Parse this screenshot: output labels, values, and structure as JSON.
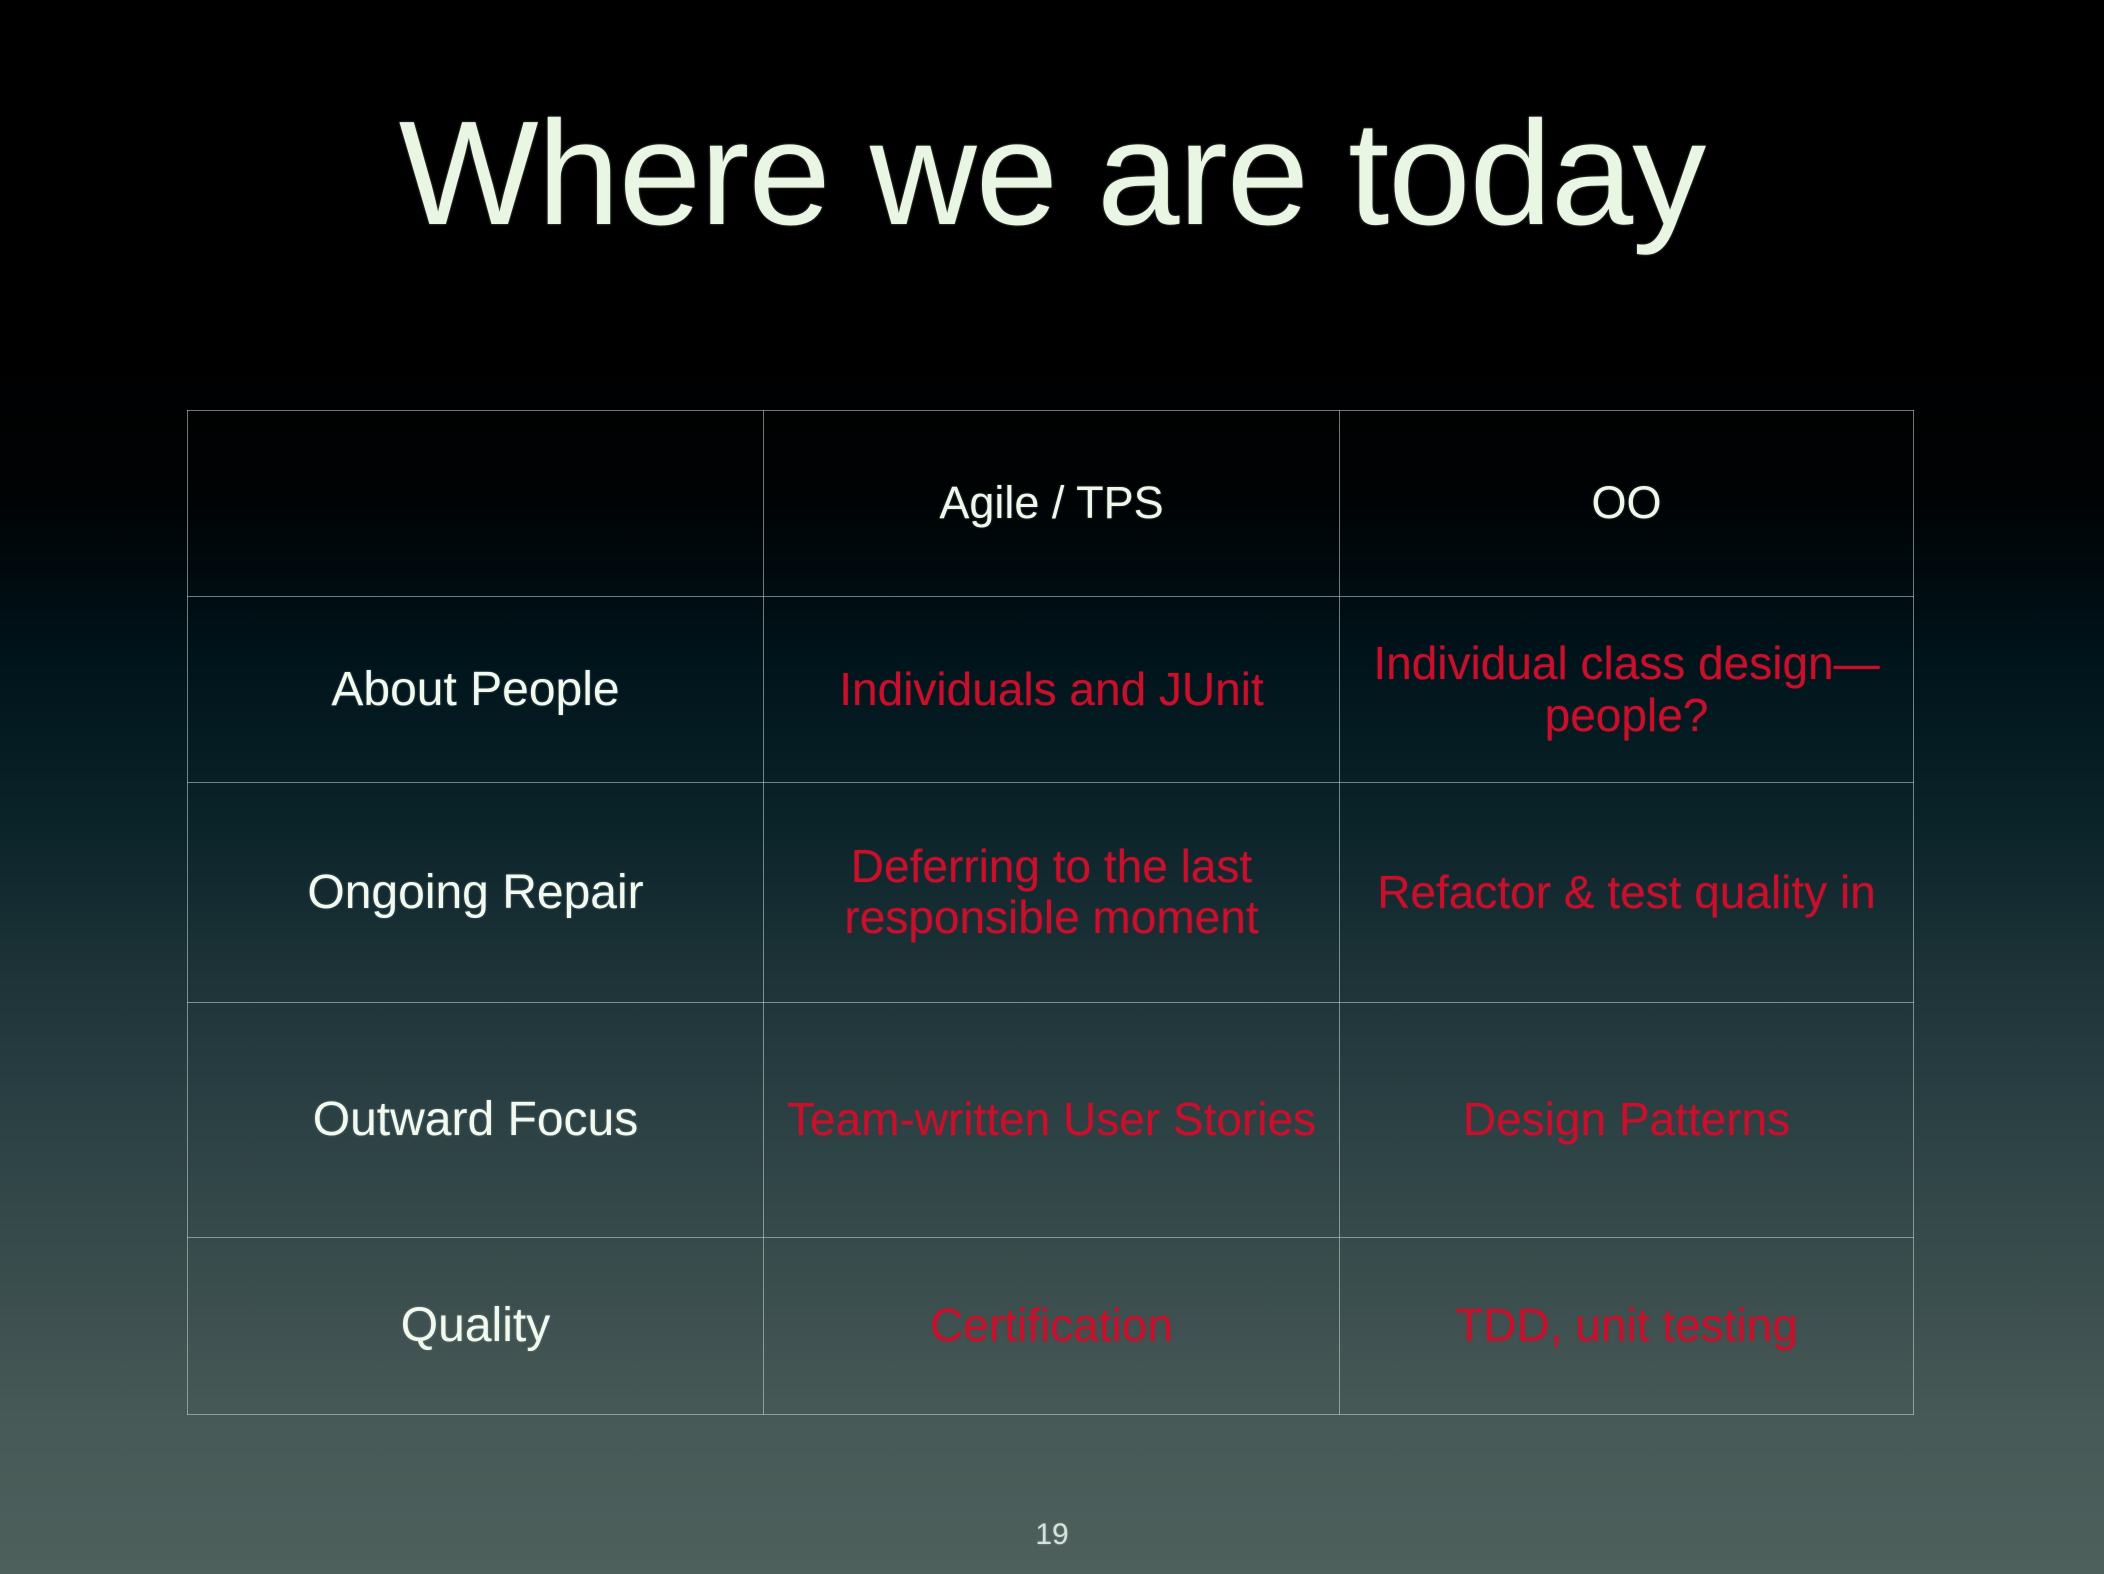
{
  "slide": {
    "title": "Where we are today",
    "page_number": "19",
    "colors": {
      "title": "#E9F6E3",
      "row_label": "#F2FAF0",
      "accent_red": "#C6102C",
      "border": "#C4DBD6",
      "bg_top": "#000000",
      "bg_bottom": "#4E605C"
    }
  },
  "table": {
    "headers": {
      "corner": "",
      "agile": "Agile / TPS",
      "oo": "OO"
    },
    "rows": [
      {
        "label": "About People",
        "agile": "Individuals and JUnit",
        "oo": "Individual class design—people?"
      },
      {
        "label": "Ongoing Repair",
        "agile": "Deferring to the last responsible moment",
        "oo": "Refactor & test quality in"
      },
      {
        "label": "Outward Focus",
        "agile": "Team-written User Stories",
        "oo": "Design Patterns"
      },
      {
        "label": "Quality",
        "agile": "Certification",
        "oo": "TDD, unit testing"
      }
    ]
  }
}
